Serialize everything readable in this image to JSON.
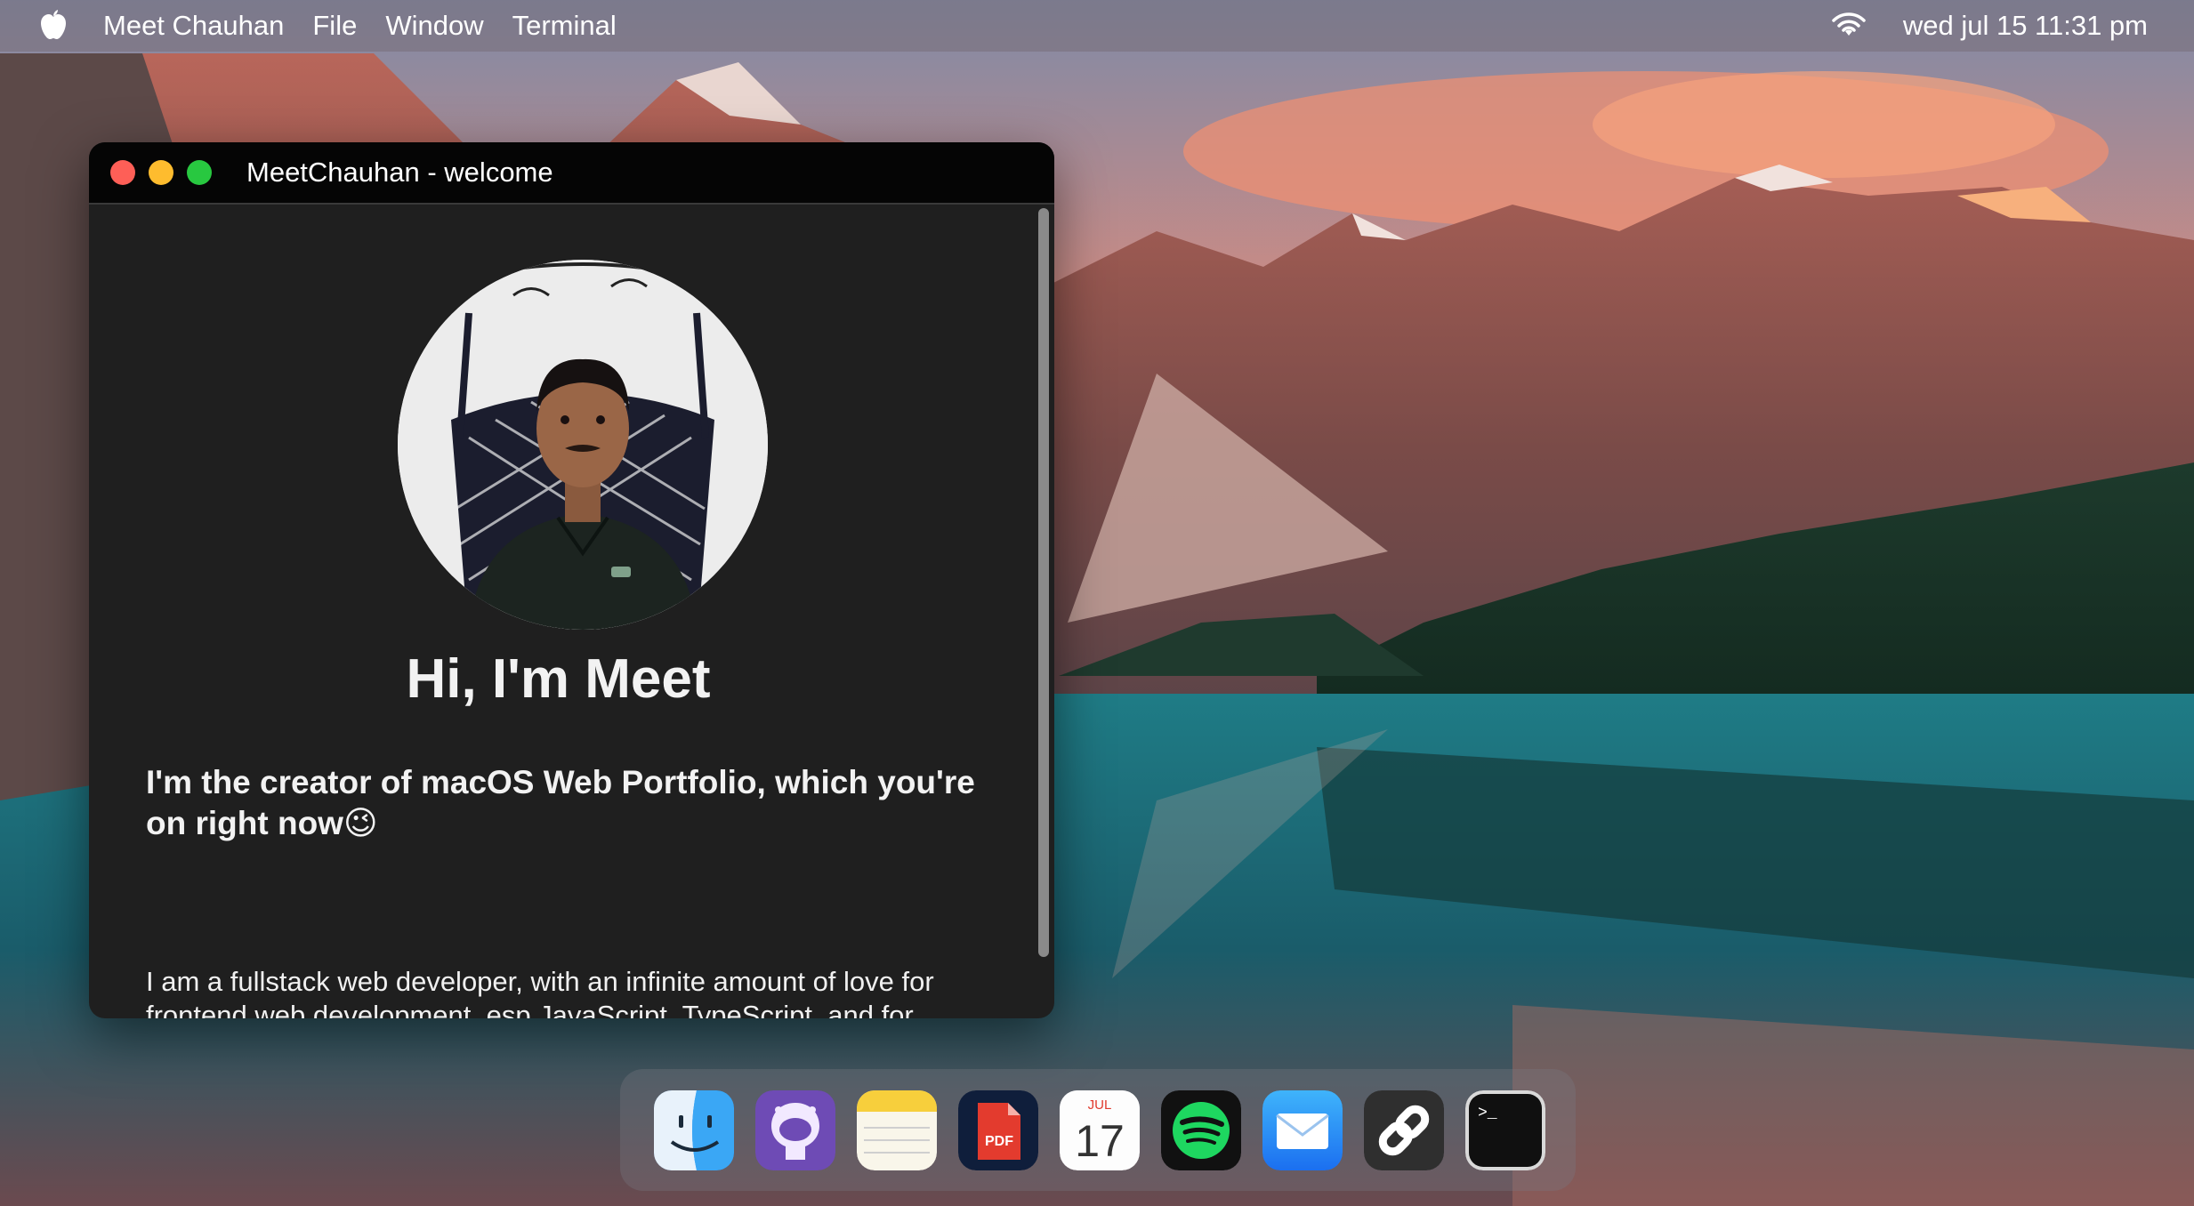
{
  "menubar": {
    "app_name": "Meet Chauhan",
    "menus": [
      "File",
      "Window",
      "Terminal"
    ],
    "clock": "wed jul 15 11:31 pm",
    "icons": [
      "apple-icon",
      "wifi-icon"
    ]
  },
  "window": {
    "title": "MeetChauhan - welcome",
    "greeting": "Hi, I'm Meet",
    "intro": "I'm the creator of macOS Web Portfolio, which you're on right now😉",
    "bio": "I am a fullstack web developer, with an infinite amount of love for frontend web development, esp JavaScript, TypeScript, and for frontend frameworks like Vue and React🤩"
  },
  "dock": {
    "items": [
      {
        "icon": "finder-icon"
      },
      {
        "icon": "github-icon"
      },
      {
        "icon": "notes-icon"
      },
      {
        "icon": "pdf-icon",
        "label": "PDF"
      },
      {
        "icon": "calendar-icon",
        "month": "JUL",
        "day": "17"
      },
      {
        "icon": "spotify-icon"
      },
      {
        "icon": "mail-icon"
      },
      {
        "icon": "link-icon"
      },
      {
        "icon": "terminal-icon",
        "prompt": ">_"
      }
    ]
  },
  "colors": {
    "close": "#fe5f57",
    "minimize": "#febc2e",
    "maximize": "#28c840",
    "window_bg": "#1f1f1f",
    "titlebar_bg": "#050505"
  }
}
